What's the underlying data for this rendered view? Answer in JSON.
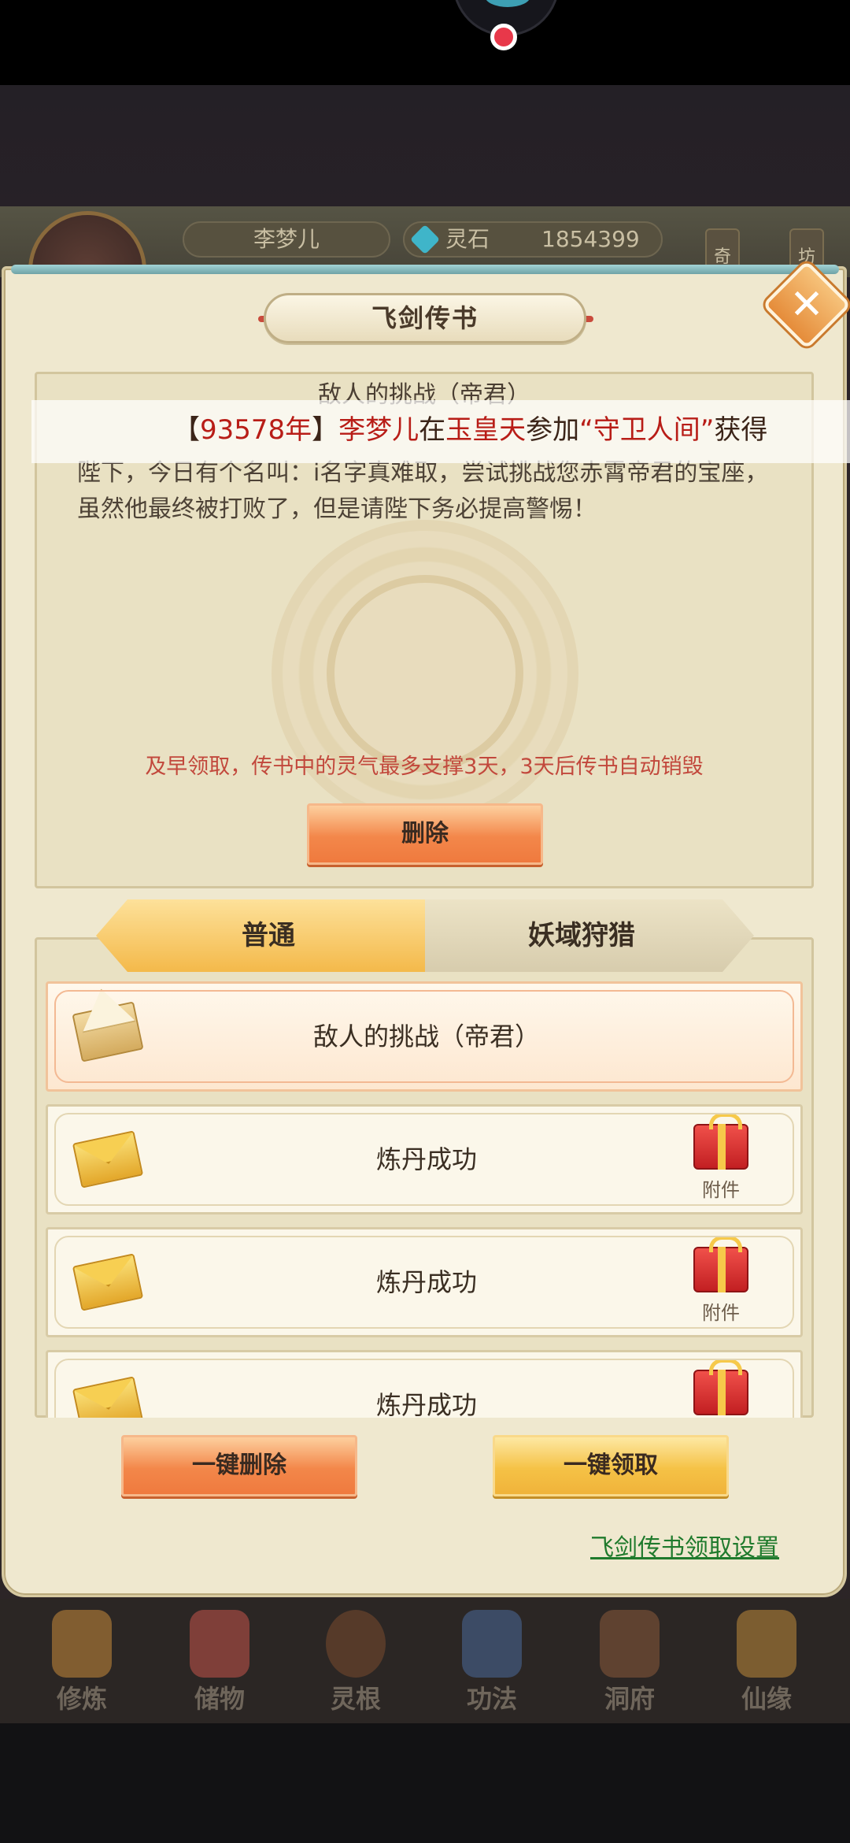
{
  "player": {
    "name": "李梦儿",
    "currency_label": "灵石",
    "currency_value": "1854399",
    "side_tags": [
      "奇",
      "坊"
    ]
  },
  "panel": {
    "title": "飞剑传书"
  },
  "detail": {
    "title": "敌人的挑战（帝君）",
    "body": "陛下，今日有个名叫：i名字真难取，尝试挑战您赤霄帝君的宝座，虽然他最终被打败了，但是请陛下务必提高警惕！",
    "notice": "及早领取，传书中的灵气最多支撑3天，3天后传书自动销毁",
    "delete_button": "删除"
  },
  "marquee": {
    "prefix": "【",
    "year": "93578年",
    "bracket_close": "】",
    "player": "李梦儿",
    "word_in": "在",
    "place": "玉皇天",
    "word_join": "参加",
    "event": "“守卫人间”",
    "suffix": "获得"
  },
  "tabs": {
    "normal": "普通",
    "hunt": "妖域狩猎"
  },
  "mails": [
    {
      "title": "敌人的挑战（帝君）",
      "opened": true,
      "attachment": ""
    },
    {
      "title": "炼丹成功",
      "opened": false,
      "attachment": "附件"
    },
    {
      "title": "炼丹成功",
      "opened": false,
      "attachment": "附件"
    },
    {
      "title": "炼丹成功",
      "opened": false,
      "attachment": ""
    }
  ],
  "actions": {
    "delete_all": "一键删除",
    "claim_all": "一键领取",
    "settings_link": "飞剑传书领取设置"
  },
  "nav": [
    "修炼",
    "储物",
    "灵根",
    "功法",
    "洞府",
    "仙缘"
  ],
  "colors": {
    "accent_orange": "#f3874a",
    "accent_gold": "#f5c246",
    "notice_red": "#c2483c",
    "marquee_red": "#b81d17",
    "link_green": "#1f7a2c"
  }
}
